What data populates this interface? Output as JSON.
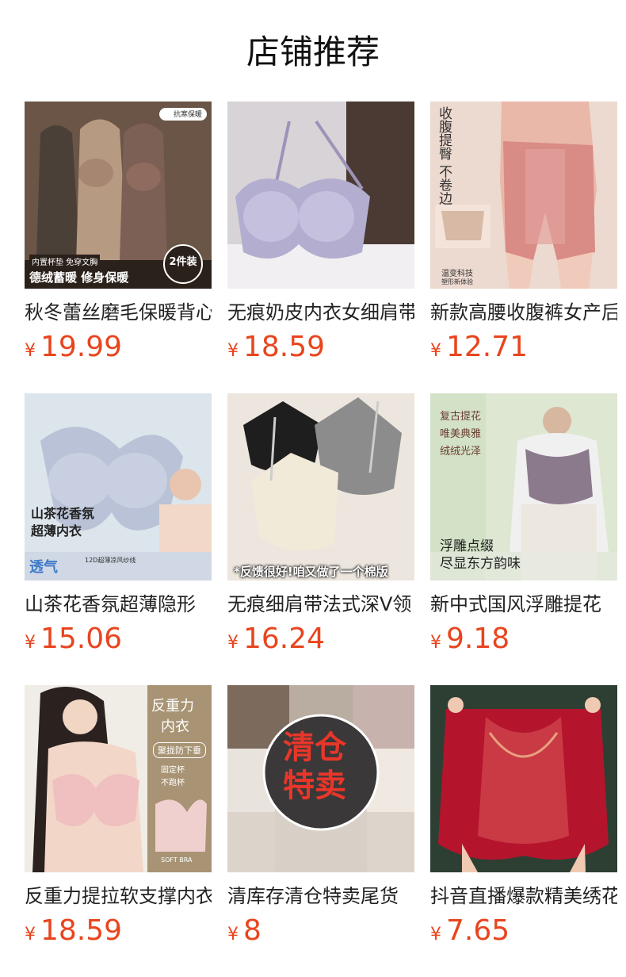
{
  "page": {
    "title": "店铺推荐"
  },
  "products": [
    {
      "name": "秋冬蕾丝磨毛保暖背心",
      "currency": "¥",
      "price": "19.99",
      "img_text1": "德绒蓄暖 修身保暖",
      "img_text2": "内置杯垫 免穿文胸",
      "img_badge": "2件装",
      "img_tag": "抗寒保暖",
      "bg": "#5d4a3e"
    },
    {
      "name": "无痕奶皮内衣女细肩带",
      "currency": "¥",
      "price": "18.59",
      "bg": "#e9e6ea"
    },
    {
      "name": "新款高腰收腹裤女产后",
      "currency": "¥",
      "price": "12.71",
      "img_text1": "收腹提臀 不卷边",
      "img_text2": "温变科技",
      "img_text3": "塑形新体验",
      "bg": "#e8cfc3"
    },
    {
      "name": "山茶花香氛超薄隐形",
      "currency": "¥",
      "price": "15.06",
      "img_text1": "山茶花香氛",
      "img_text2": "超薄内衣",
      "img_text3": "透气",
      "img_text4": "12D超薄凉风纱线",
      "bg": "#e6edf4"
    },
    {
      "name": "无痕细肩带法式深V领",
      "currency": "¥",
      "price": "16.24",
      "img_text1": "*反馈很好!咱又做了一个棉版",
      "bg": "#efe9e1"
    },
    {
      "name": "新中式国风浮雕提花",
      "currency": "¥",
      "price": "9.18",
      "img_text1": "复古提花",
      "img_text2": "唯美典雅",
      "img_text3": "绒绒光泽",
      "img_text4": "浮雕点缀",
      "img_text5": "尽显东方韵味",
      "bg": "#dfe9d6"
    },
    {
      "name": "反重力提拉软支撑内衣",
      "currency": "¥",
      "price": "18.59",
      "img_text1": "反重力",
      "img_text2": "内衣",
      "img_text3": "聚拢防下垂",
      "img_text4": "固定杯",
      "img_text5": "不跑杯",
      "img_text6": "SOFT BRA",
      "bg": "#f1ede8"
    },
    {
      "name": "清库存清仓特卖尾货",
      "currency": "¥",
      "price": "8",
      "img_text1": "清仓",
      "img_text2": "特卖",
      "bg": "#cfc7bf"
    },
    {
      "name": "抖音直播爆款精美绣花",
      "currency": "¥",
      "price": "7.65",
      "bg": "#2f4136"
    }
  ]
}
